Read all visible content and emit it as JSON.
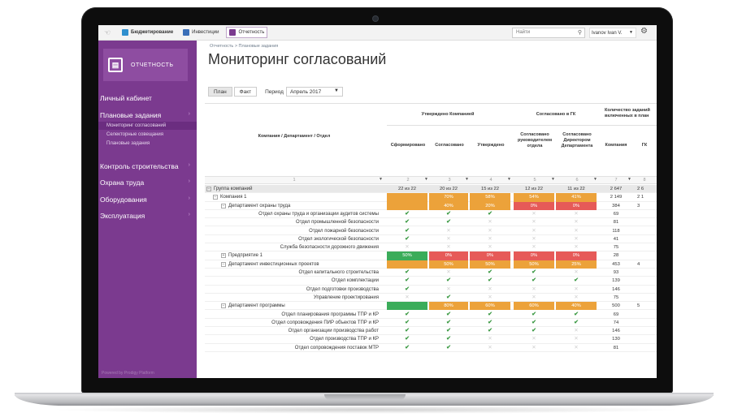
{
  "topbar": {
    "tabs": [
      {
        "label": "Бюджетирование",
        "color": "#2f8fce"
      },
      {
        "label": "Инвестиции",
        "color": "#3a6fb8"
      },
      {
        "label": "Отчетность",
        "color": "#7b3a8f"
      }
    ],
    "search_placeholder": "Найти",
    "user": "Ivanov Ivan V."
  },
  "sidebar": {
    "brand": "ОТЧЕТНОСТЬ",
    "items": [
      {
        "label": "Личный кабинет"
      },
      {
        "label": "Плановые задания"
      },
      {
        "label": "Контроль строительства"
      },
      {
        "label": "Охрана труда"
      },
      {
        "label": "Оборудования"
      },
      {
        "label": "Эксплуатация"
      }
    ],
    "sub_items": [
      {
        "label": "Мониторинг согласований"
      },
      {
        "label": "Селекторные совещания"
      },
      {
        "label": "Плановые задания"
      }
    ],
    "powered": "Powered by Prodigy Platform",
    "accent": "#7b3a8f"
  },
  "main": {
    "breadcrumb": "Отчетность  >  Плановые задания",
    "title": "Мониторинг согласований",
    "tab_plan": "План",
    "tab_fact": "Факт",
    "period_label": "Период",
    "period_value": "Апрель 2017"
  },
  "table": {
    "col_company": "Компания / Департамент / Отдел",
    "group_approved_company": "Утверждено Компанией",
    "group_gk": "Согласовано в ГК",
    "group_count": "Количество заданий включенных в план",
    "sub": [
      "Сформировано",
      "Согласовано",
      "Утверждено",
      "Согласовано руководителем отдела",
      "Согласовано Директором Департамента",
      "Компания",
      "ГК"
    ],
    "nums": [
      "1",
      "2",
      "3",
      "4",
      "5",
      "6",
      "7",
      "8"
    ],
    "rows": [
      {
        "name": "Группа компаний",
        "level": 0,
        "exp": "−",
        "group": true,
        "c": [
          "22 из 22",
          "20 из 22",
          "15 из 22",
          "12 из 22",
          "11 из 22"
        ],
        "s": [
          "",
          "",
          "",
          "",
          ""
        ],
        "k": "2 647",
        "g": "2 6"
      },
      {
        "name": "Компания 1",
        "level": 1,
        "exp": "−",
        "c": [
          "",
          "70%",
          "58%",
          "54%",
          "41%"
        ],
        "s": [
          "o",
          "o",
          "o",
          "o",
          "o"
        ],
        "k": "2 149",
        "g": "2 1"
      },
      {
        "name": "Департамент охраны труда",
        "level": 2,
        "exp": "−",
        "c": [
          "",
          "40%",
          "20%",
          "0%",
          "0%"
        ],
        "s": [
          "o",
          "o",
          "o",
          "r",
          "r"
        ],
        "k": "384",
        "g": "3"
      },
      {
        "name": "Отдел охраны труда и организации аудитов системы",
        "level": 3,
        "c": [
          "✔",
          "✔",
          "✔",
          "✕",
          "✕"
        ],
        "k": "69",
        "g": ""
      },
      {
        "name": "Отдел промышленной безопасности",
        "level": 3,
        "c": [
          "✔",
          "✔",
          "✕",
          "✕",
          "✕"
        ],
        "k": "81",
        "g": ""
      },
      {
        "name": "Отдел пожарной безопасности",
        "level": 3,
        "c": [
          "✔",
          "✕",
          "✕",
          "✕",
          "✕"
        ],
        "k": "118",
        "g": ""
      },
      {
        "name": "Отдел экологической безопасности",
        "level": 3,
        "c": [
          "✔",
          "✕",
          "✕",
          "✕",
          "✕"
        ],
        "k": "41",
        "g": ""
      },
      {
        "name": "Служба безопасности дорожного движения",
        "level": 3,
        "c": [
          "✕",
          "✕",
          "✕",
          "✕",
          "✕"
        ],
        "k": "75",
        "g": ""
      },
      {
        "name": "Предприятие 1",
        "level": 2,
        "exp": "+",
        "c": [
          "50%",
          "0%",
          "0%",
          "0%",
          "0%"
        ],
        "s": [
          "g",
          "r",
          "r",
          "r",
          "r"
        ],
        "k": "28",
        "g": ""
      },
      {
        "name": "Департамент инвестиционных проектов",
        "level": 2,
        "exp": "−",
        "c": [
          "",
          "50%",
          "50%",
          "50%",
          "25%"
        ],
        "s": [
          "o",
          "o",
          "o",
          "o",
          "o"
        ],
        "k": "453",
        "g": "4"
      },
      {
        "name": "Отдел капитального строительства",
        "level": 3,
        "c": [
          "✔",
          "✕",
          "✔",
          "✔",
          "✕"
        ],
        "k": "93",
        "g": ""
      },
      {
        "name": "Отдел комплектации",
        "level": 3,
        "c": [
          "✔",
          "✔",
          "✔",
          "✔",
          "✔"
        ],
        "k": "139",
        "g": ""
      },
      {
        "name": "Отдел подготовки производства",
        "level": 3,
        "c": [
          "✔",
          "✕",
          "✕",
          "✕",
          "✕"
        ],
        "k": "146",
        "g": ""
      },
      {
        "name": "Управление проектирования",
        "level": 3,
        "c": [
          "✕",
          "✔",
          "✕",
          "✕",
          "✕"
        ],
        "k": "75",
        "g": ""
      },
      {
        "name": "Департамент программы",
        "level": 2,
        "exp": "−",
        "c": [
          "",
          "80%",
          "60%",
          "60%",
          "40%"
        ],
        "s": [
          "g",
          "o",
          "o",
          "o",
          "o"
        ],
        "k": "500",
        "g": "5"
      },
      {
        "name": "Отдел планирования программы ТПР и КР",
        "level": 3,
        "c": [
          "✔",
          "✔",
          "✔",
          "✔",
          "✔"
        ],
        "k": "69",
        "g": ""
      },
      {
        "name": "Отдел сопровождения ПИР объектов ТПР и КР",
        "level": 3,
        "c": [
          "✔",
          "✔",
          "✔",
          "✔",
          "✔"
        ],
        "k": "74",
        "g": ""
      },
      {
        "name": "Отдел организации производства работ",
        "level": 3,
        "c": [
          "✔",
          "✔",
          "✔",
          "✔",
          "✕"
        ],
        "k": "146",
        "g": ""
      },
      {
        "name": "Отдел производства ТПР и КР",
        "level": 3,
        "c": [
          "✔",
          "✔",
          "✕",
          "✕",
          "✕"
        ],
        "k": "130",
        "g": ""
      },
      {
        "name": "Отдел сопровождения поставок МТР",
        "level": 3,
        "c": [
          "✔",
          "✔",
          "✕",
          "✕",
          "✕"
        ],
        "k": "81",
        "g": ""
      }
    ]
  }
}
